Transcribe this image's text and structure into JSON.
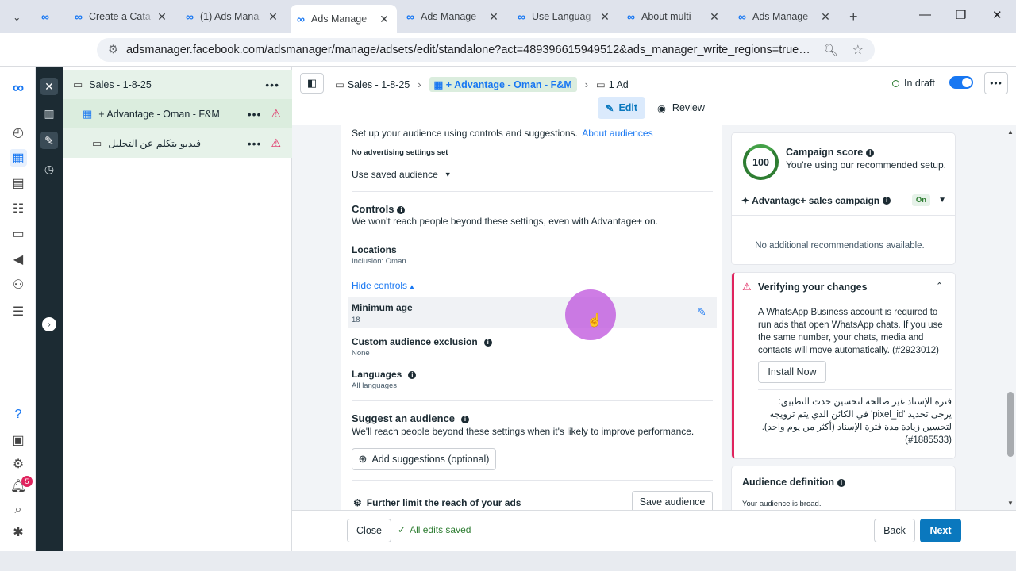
{
  "browser": {
    "tabs": [
      {
        "title": ""
      },
      {
        "title": "Create a Cata"
      },
      {
        "title": "(1) Ads Mana"
      },
      {
        "title": "Ads Manage"
      },
      {
        "title": "Ads Manage"
      },
      {
        "title": "Use Languag"
      },
      {
        "title": "About multi"
      },
      {
        "title": "Ads Manage"
      }
    ],
    "url": "adsmanager.facebook.com/adsmanager/manage/adsets/edit/standalone?act=489396615949512&ads_manager_write_regions=true&business_id..."
  },
  "rail": {
    "notif_count": "5"
  },
  "tree": {
    "campaign": "Sales - 1-8-25",
    "adset": "+ Advantage - Oman - F&M",
    "ad": "فيديو يتكلم عن التحليل"
  },
  "header": {
    "crumb_campaign": "Sales - 1-8-25",
    "crumb_adset": "+ Advantage - Oman - F&M",
    "crumb_ad": "1 Ad",
    "status": "In draft",
    "edit_label": "Edit",
    "review_label": "Review"
  },
  "audience": {
    "intro": "Set up your audience using controls and suggestions.",
    "intro_link": "About audiences",
    "no_settings": "No advertising settings set",
    "saved_audience": "Use saved audience",
    "controls_title": "Controls",
    "controls_desc": "We won't reach people beyond these settings, even with Advantage+ on.",
    "locations_label": "Locations",
    "locations_value": "Inclusion: Oman",
    "hide_controls": "Hide controls",
    "min_age_label": "Minimum age",
    "min_age_value": "18",
    "exclusion_label": "Custom audience exclusion",
    "exclusion_value": "None",
    "languages_label": "Languages",
    "languages_value": "All languages",
    "suggest_title": "Suggest an audience",
    "suggest_desc": "We'll reach people beyond these settings when it's likely to improve performance.",
    "add_suggestions": "Add suggestions (optional)",
    "further_limit": "Further limit the reach of your ads",
    "save_audience": "Save audience"
  },
  "score": {
    "value": "100",
    "title": "Campaign score",
    "desc": "You're using our recommended setup.",
    "advantage_label": "Advantage+ sales campaign",
    "advantage_status": "On",
    "no_recs": "No additional recommendations available."
  },
  "verify": {
    "title": "Verifying your changes",
    "message": "A WhatsApp Business account is required to run ads that open WhatsApp chats. If you use the same number, your chats, media and contacts will move automatically. (#2923012)",
    "install": "Install Now",
    "arabic": "فترة الإسناد غير صالحة لتحسين حدث التطبيق: يرجى تحديد 'pixel_id' في الكائن الذي يتم ترويجه لتحسين زيادة مدة فترة الإسناد (أكثر من يوم واحد). (1885533#)"
  },
  "definition": {
    "title": "Audience definition",
    "desc": "Your audience is broad."
  },
  "bottom": {
    "close": "Close",
    "saved": "All edits saved",
    "back": "Back",
    "next": "Next"
  },
  "colors": {
    "accent": "#1877f2",
    "primary_btn": "#0a78be",
    "warning": "#e0245e",
    "score_ring": "#2e7d32"
  }
}
